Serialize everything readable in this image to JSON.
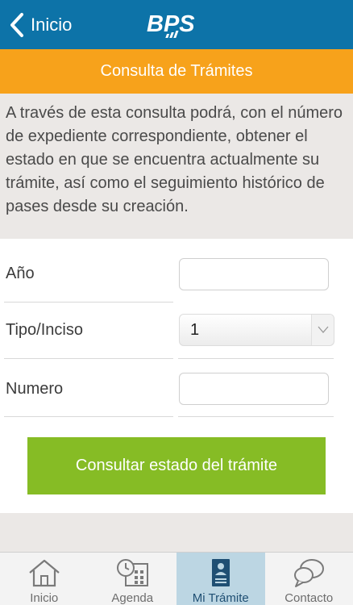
{
  "header": {
    "back_label": "Inicio",
    "logo_text": "BPS",
    "bg_color": "#0d73a8"
  },
  "subheader": {
    "title": "Consulta de Trámites",
    "bg_color": "#f7a21b"
  },
  "intro": {
    "text": "A través de esta consulta podrá, con el número de expediente correspondiente, obtener el estado en que se encuentra actualmente su trámite, así como el seguimiento histórico de pases desde su creación."
  },
  "form": {
    "year": {
      "label": "Año",
      "value": ""
    },
    "type": {
      "label": "Tipo/Inciso",
      "value": "1"
    },
    "number": {
      "label": "Numero",
      "value": ""
    },
    "submit_label": "Consultar estado del trámite",
    "submit_color": "#86bc25"
  },
  "tabbar": {
    "tabs": [
      {
        "label": "Inicio",
        "icon": "home-icon"
      },
      {
        "label": "Agenda",
        "icon": "calendar-clock-icon"
      },
      {
        "label": "Mi Trámite",
        "icon": "document-user-icon",
        "active": true
      },
      {
        "label": "Contacto",
        "icon": "chat-bubbles-icon"
      }
    ]
  }
}
